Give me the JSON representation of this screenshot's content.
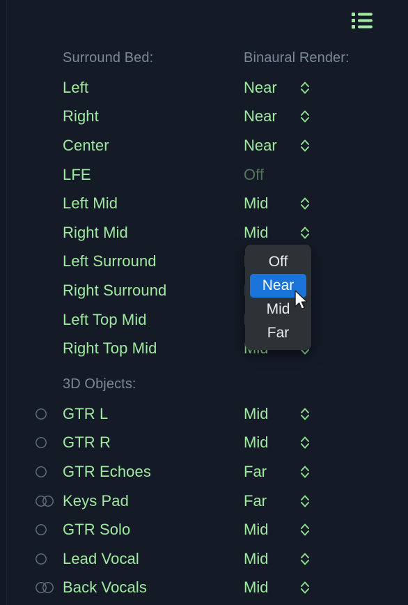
{
  "theme": {
    "background": "#141b27",
    "gutter": "#121825",
    "accent_green": "#a0e9a0",
    "dim_green": "#56745a",
    "label_gray": "#7c8796",
    "popup_bg": "#2d3237",
    "popup_selected": "#1a73d8",
    "popup_text": "#e9eaec"
  },
  "header": {
    "list_icon_name": "list-icon"
  },
  "sections": [
    {
      "id": "surround-bed",
      "label": "Surround Bed:",
      "value_label": "Binaural Render:",
      "rows": [
        {
          "name": "Left",
          "value": "Near",
          "stepper": true,
          "dimmed": false,
          "channel": null
        },
        {
          "name": "Right",
          "value": "Near",
          "stepper": true,
          "dimmed": false,
          "channel": null
        },
        {
          "name": "Center",
          "value": "Near",
          "stepper": true,
          "dimmed": false,
          "channel": null
        },
        {
          "name": "LFE",
          "value": "Off",
          "stepper": false,
          "dimmed": true,
          "channel": null
        },
        {
          "name": "Left Mid",
          "value": "Mid",
          "stepper": true,
          "dimmed": false,
          "channel": null
        },
        {
          "name": "Right Mid",
          "value": "Mid",
          "stepper": true,
          "dimmed": false,
          "channel": null
        },
        {
          "name": "Left Surround",
          "value": "Mid",
          "stepper": true,
          "dimmed": false,
          "channel": null
        },
        {
          "name": "Right Surround",
          "value": "Mid",
          "stepper": true,
          "dimmed": false,
          "channel": null
        },
        {
          "name": "Left Top Mid",
          "value": "Mid",
          "stepper": true,
          "dimmed": false,
          "channel": null
        },
        {
          "name": "Right Top Mid",
          "value": "Mid",
          "stepper": true,
          "dimmed": false,
          "channel": null
        }
      ]
    },
    {
      "id": "3d-objects",
      "label": "3D Objects:",
      "value_label": "",
      "rows": [
        {
          "name": "GTR L",
          "value": "Mid",
          "stepper": true,
          "dimmed": false,
          "channel": "mono"
        },
        {
          "name": "GTR R",
          "value": "Mid",
          "stepper": true,
          "dimmed": false,
          "channel": "mono"
        },
        {
          "name": "GTR Echoes",
          "value": "Far",
          "stepper": true,
          "dimmed": false,
          "channel": "mono"
        },
        {
          "name": "Keys Pad",
          "value": "Far",
          "stepper": true,
          "dimmed": false,
          "channel": "stereo"
        },
        {
          "name": "GTR Solo",
          "value": "Mid",
          "stepper": true,
          "dimmed": false,
          "channel": "mono"
        },
        {
          "name": "Lead Vocal",
          "value": "Mid",
          "stepper": true,
          "dimmed": false,
          "channel": "mono"
        },
        {
          "name": "Back Vocals",
          "value": "Mid",
          "stepper": true,
          "dimmed": false,
          "channel": "stereo"
        }
      ]
    }
  ],
  "dropdown": {
    "open": true,
    "anchor_row": "Right Mid",
    "options": [
      "Off",
      "Near",
      "Mid",
      "Far"
    ],
    "selected": "Near"
  }
}
